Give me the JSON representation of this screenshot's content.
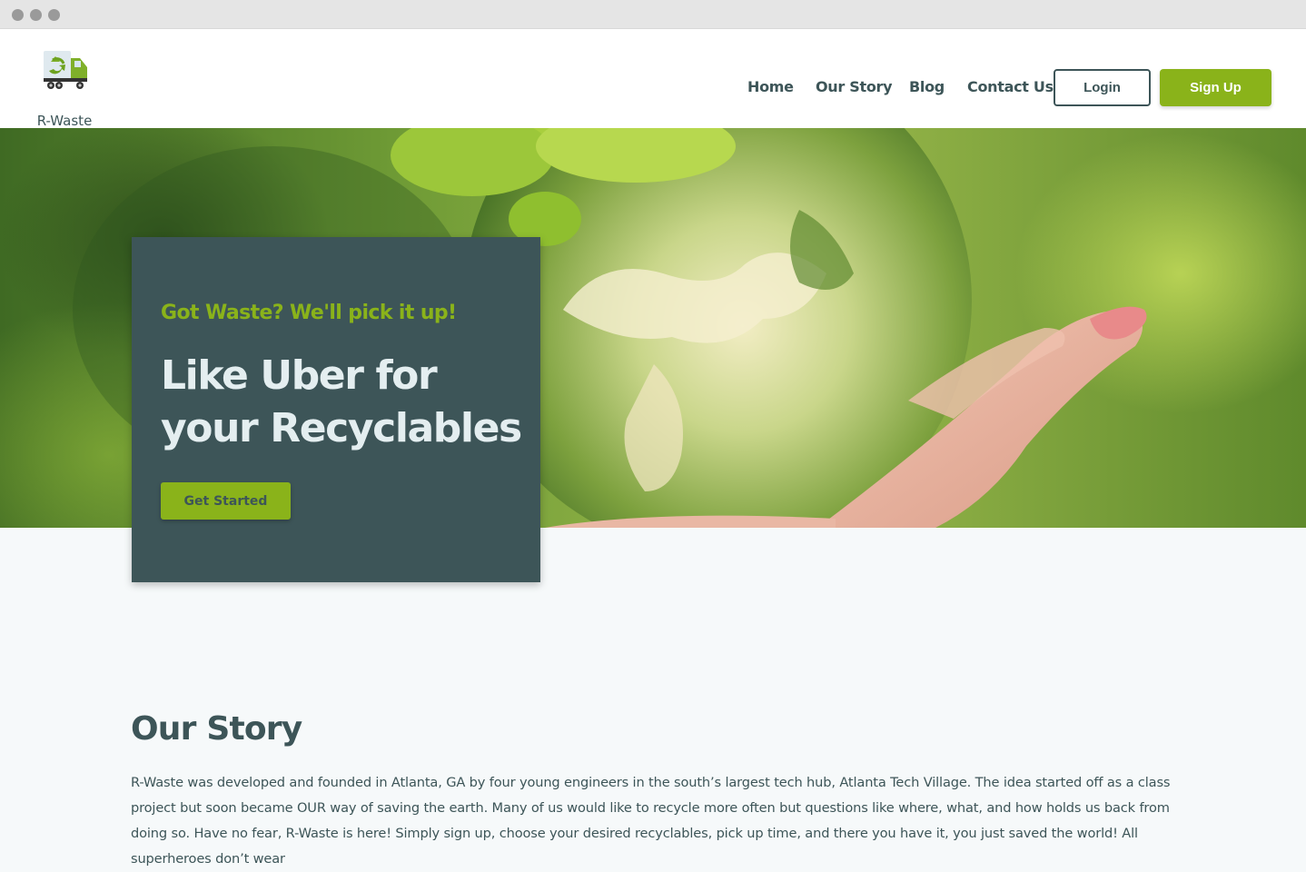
{
  "browser": {
    "buttons": [
      "close",
      "minimize",
      "maximize"
    ]
  },
  "brand": {
    "name": "R-Waste",
    "logo_icon": "recycling-truck-icon"
  },
  "nav": {
    "links": [
      "Home",
      "Our Story",
      "Blog",
      "Contact Us"
    ],
    "login_label": "Login",
    "signup_label": "Sign Up"
  },
  "hero": {
    "kicker": "Got Waste? We'll pick it up!",
    "title": "Like Uber for your Recyclables",
    "cta_label": "Get Started",
    "image": "green-globe-in-hand"
  },
  "story": {
    "title": "Our Story",
    "body": "R-Waste was developed and founded in Atlanta, GA by four young engineers in the south’s largest tech hub, Atlanta Tech Village. The idea started off as a class project but soon became OUR way of saving the earth. Many of us would like to recycle more often but questions like where, what, and how holds us back from doing so. Have no fear, R-Waste is here! Simply sign up, choose your desired recyclables, pick up time, and there you have it, you just saved the world! All superheroes don’t wear"
  },
  "colors": {
    "primary_dark": "#3d5558",
    "accent_green": "#8ab31a",
    "page_bg": "#f6f9fa"
  }
}
